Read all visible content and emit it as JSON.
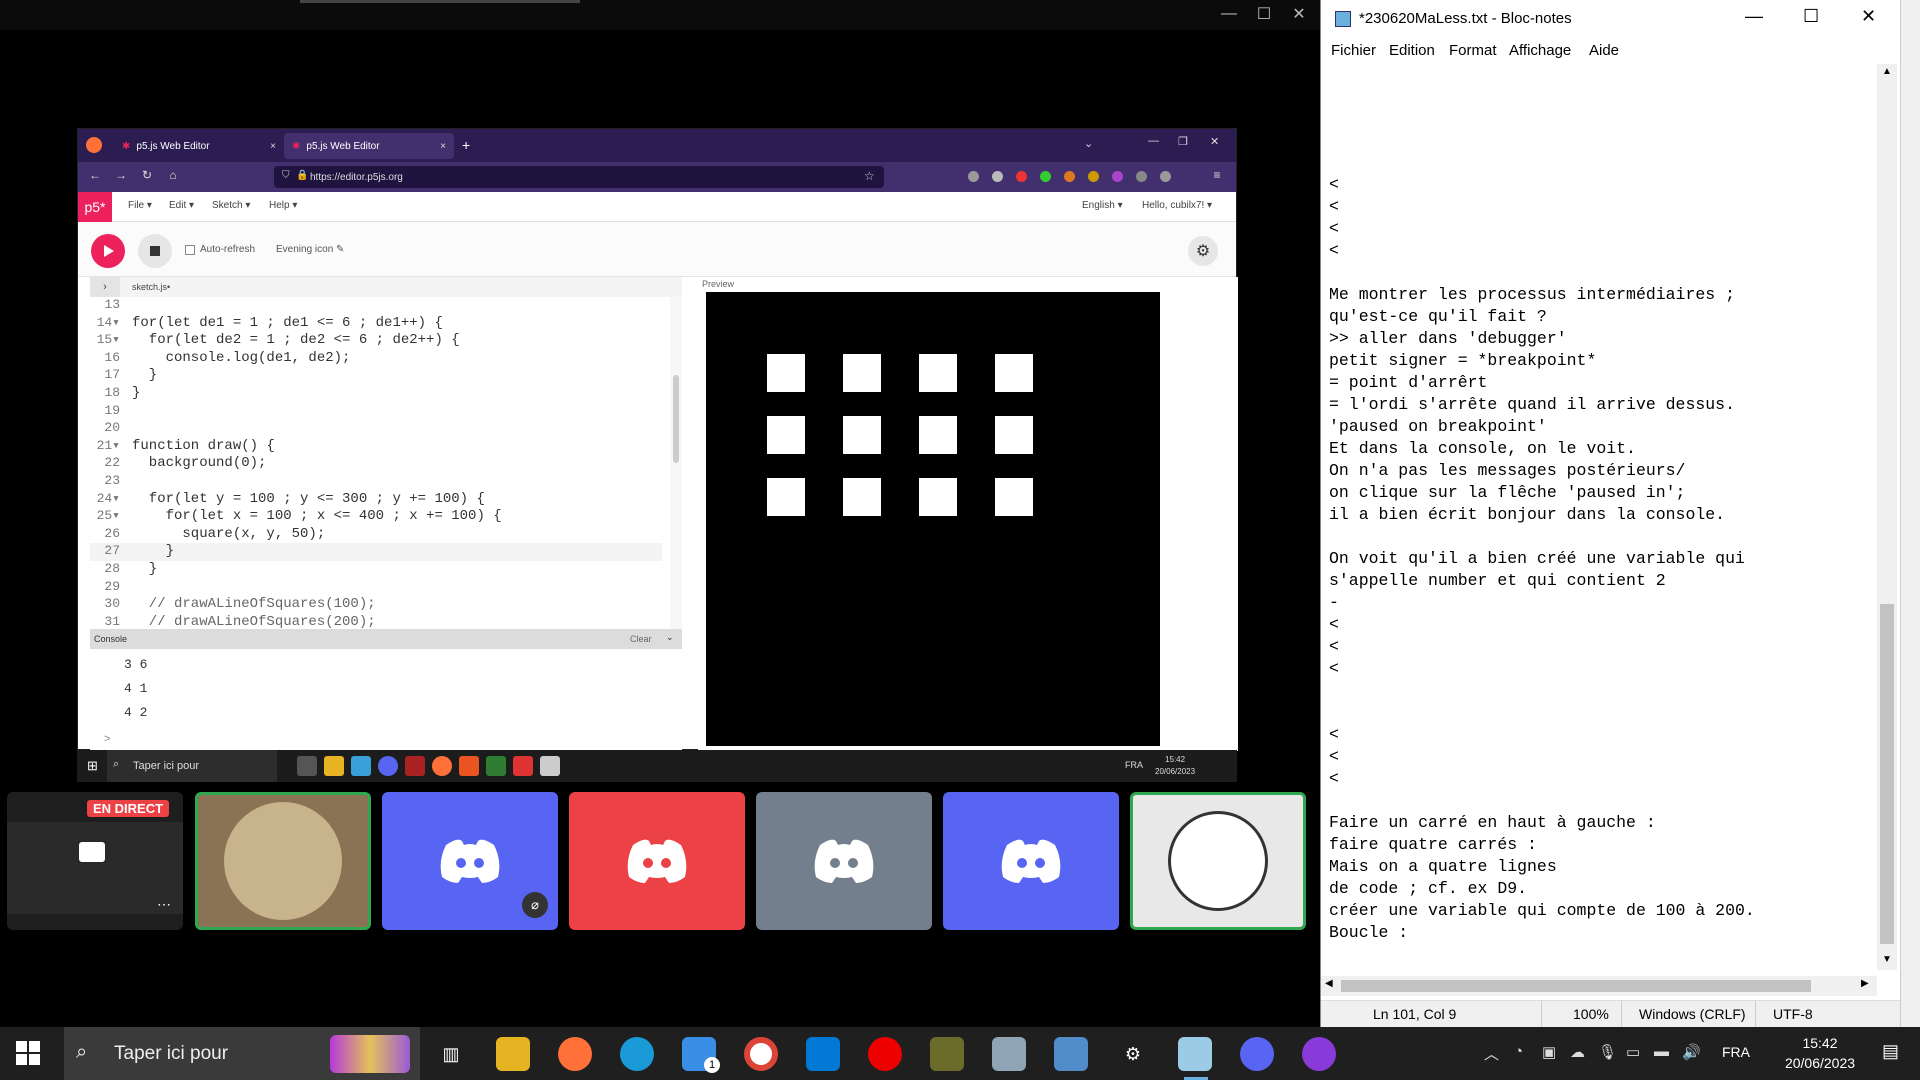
{
  "stage": {
    "live_badge": "EN DIRECT",
    "browser": {
      "tabs": [
        {
          "label": "p5.js Web Editor",
          "close": "×"
        },
        {
          "label": "p5.js Web Editor",
          "close": "×"
        }
      ],
      "new_tab": "+",
      "url": "https://editor.p5js.org",
      "p5_logo": "p5*",
      "menus": [
        "File ▾",
        "Edit ▾",
        "Sketch ▾",
        "Help ▾"
      ],
      "language": "English ▾",
      "user": "Hello, cubilx7! ▾",
      "auto_refresh_label": "Auto-refresh",
      "sketch_name": "Evening icon ✎",
      "file_tab": "sketch.js•",
      "preview_label": "Preview",
      "console_label": "Console",
      "console_clear": "Clear",
      "code_lines": [
        {
          "n": "13",
          "t": ""
        },
        {
          "n": "14▾",
          "t": "for(let de1 = 1 ; de1 <= 6 ; de1++) {"
        },
        {
          "n": "15▾",
          "t": "  for(let de2 = 1 ; de2 <= 6 ; de2++) {"
        },
        {
          "n": "16",
          "t": "    console.log(de1, de2);"
        },
        {
          "n": "17",
          "t": "  }"
        },
        {
          "n": "18",
          "t": "}"
        },
        {
          "n": "19",
          "t": ""
        },
        {
          "n": "20",
          "t": ""
        },
        {
          "n": "21▾",
          "t": "function draw() {"
        },
        {
          "n": "22",
          "t": "  background(0);"
        },
        {
          "n": "23",
          "t": ""
        },
        {
          "n": "24▾",
          "t": "  for(let y = 100 ; y <= 300 ; y += 100) {"
        },
        {
          "n": "25▾",
          "t": "    for(let x = 100 ; x <= 400 ; x += 100) {"
        },
        {
          "n": "26",
          "t": "      square(x, y, 50);"
        },
        {
          "n": "27",
          "t": "    }"
        },
        {
          "n": "28",
          "t": "  }"
        },
        {
          "n": "29",
          "t": ""
        },
        {
          "n": "30",
          "t": "  // drawALineOfSquares(100);"
        },
        {
          "n": "31",
          "t": "  // drawALineOfSquares(200);"
        }
      ],
      "console_lines": [
        "3 6",
        "4 1",
        "4 2"
      ],
      "console_prompt": ">"
    },
    "inner_taskbar": {
      "search": "Taper ici pour",
      "lang": "FRA",
      "time": "15:42",
      "date": "20/06/2023"
    }
  },
  "notepad": {
    "title": "*230620MaLess.txt - Bloc-notes",
    "menu": [
      "Fichier",
      "Edition",
      "Format",
      "Affichage",
      "Aide"
    ],
    "text": "\n\n\n\n\n<\n<\n<\n<\n\nMe montrer les processus intermédiaires ;\nqu'est-ce qu'il fait ?\n>> aller dans 'debugger'\npetit signer = *breakpoint*\n= point d'arrêrt\n= l'ordi s'arrête quand il arrive dessus.\n'paused on breakpoint'\nEt dans la console, on le voit.\nOn n'a pas les messages postérieurs/\non clique sur la flêche 'paused in';\nil a bien écrit bonjour dans la console.\n\nOn voit qu'il a bien créé une variable qui\ns'appelle number et qui contient 2\n-\n<\n<\n<\n\n\n<\n<\n<\n\nFaire un carré en haut à gauche :\nfaire quatre carrés :\nMais on a quatre lignes\nde code ; cf. ex D9.\ncréer une variable qui compte de 100 à 200.\nBoucle :",
    "status": {
      "position": "Ln 101, Col 9",
      "zoom": "100%",
      "eol": "Windows (CRLF)",
      "encoding": "UTF-8"
    }
  },
  "taskbar": {
    "search": "Taper ici pour",
    "lang": "FRA",
    "time": "15:42",
    "date": "20/06/2023",
    "mail_badge": "1"
  },
  "colors": {
    "discord_blurple": "#5865f2",
    "discord_red": "#ed4245",
    "discord_grey": "#747f8d",
    "p5_pink": "#ed225d",
    "speaking_green": "#2fa84f"
  }
}
